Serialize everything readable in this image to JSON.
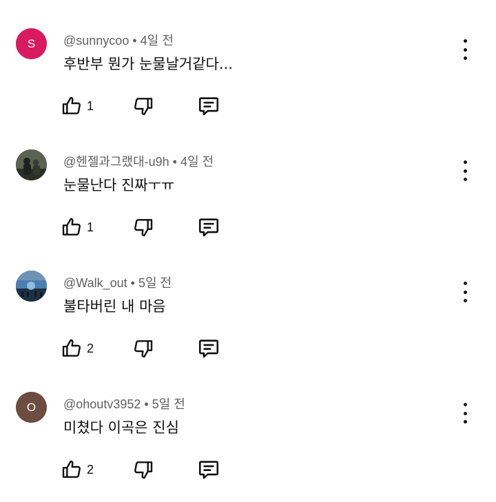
{
  "comments": [
    {
      "avatar_letter": "S",
      "avatar_color": "#d81b60",
      "author": "@sunnycoo",
      "time": "4일 전",
      "text": "후반부 뭔가 눈물날거같다...",
      "likes": "1"
    },
    {
      "avatar_letter": "",
      "avatar_color": "#4a5046",
      "author": "@헨젤과그랬대-u9h",
      "time": "4일 전",
      "text": "눈물난다 진짜ㅜㅠ",
      "likes": "1"
    },
    {
      "avatar_letter": "",
      "avatar_color": "#3a5a78",
      "author": "@Walk_out",
      "time": "5일 전",
      "text": "불타버린 내 마음",
      "likes": "2"
    },
    {
      "avatar_letter": "O",
      "avatar_color": "#6d4c41",
      "author": "@ohoutv3952",
      "time": "5일 전",
      "text": "미쳤다 이곡은 진심",
      "likes": "2"
    }
  ],
  "separator": "•",
  "icons": {
    "like": "thumbs-up-icon",
    "dislike": "thumbs-down-icon",
    "reply": "reply-icon",
    "more": "more-vert-icon"
  }
}
